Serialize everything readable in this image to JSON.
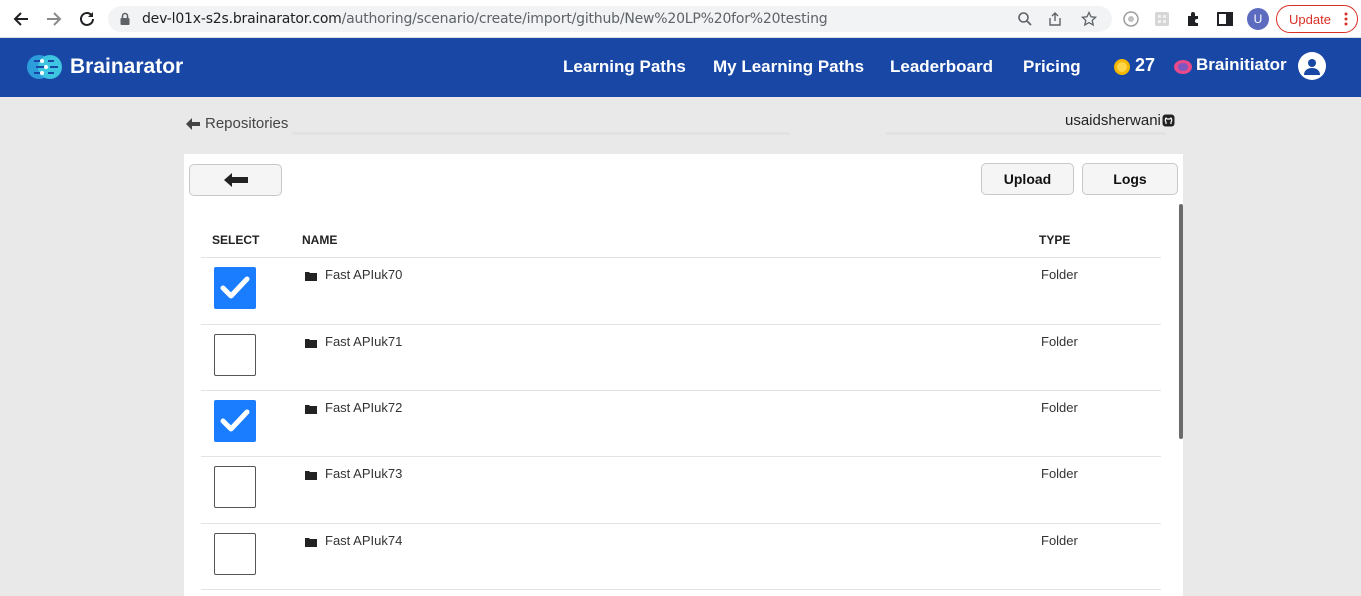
{
  "browser": {
    "url_host": "dev-l01x-s2s.brainarator.com",
    "url_path": "/authoring/scenario/create/import/github/New%20LP%20for%20testing",
    "profile_initial": "U",
    "update_label": "Update"
  },
  "header": {
    "brand": "Brainarator",
    "nav": [
      "Learning Paths",
      "My Learning Paths",
      "Leaderboard",
      "Pricing"
    ],
    "coins": "27",
    "user_name": "Brainitiator"
  },
  "page": {
    "back_link": "Repositories",
    "github_user": "usaidsherwani",
    "upload_label": "Upload",
    "logs_label": "Logs"
  },
  "table": {
    "columns": [
      "SELECT",
      "NAME",
      "TYPE"
    ],
    "rows": [
      {
        "name": "Fast APIuk70",
        "type": "Folder",
        "selected": true
      },
      {
        "name": "Fast APIuk71",
        "type": "Folder",
        "selected": false
      },
      {
        "name": "Fast APIuk72",
        "type": "Folder",
        "selected": true
      },
      {
        "name": "Fast APIuk73",
        "type": "Folder",
        "selected": false
      },
      {
        "name": "Fast APIuk74",
        "type": "Folder",
        "selected": false
      }
    ]
  },
  "icons": [
    "back-arrow-icon",
    "forward-arrow-icon",
    "reload-icon",
    "lock-icon",
    "zoom-icon",
    "share-icon",
    "star-icon",
    "puzzle-icon",
    "sidebar-icon",
    "coin-icon",
    "github-icon",
    "folder-icon",
    "checkmark-icon"
  ],
  "colors": {
    "appbar": "#1847a6",
    "checkbox_on": "#1a7dff",
    "update": "#d93025"
  }
}
